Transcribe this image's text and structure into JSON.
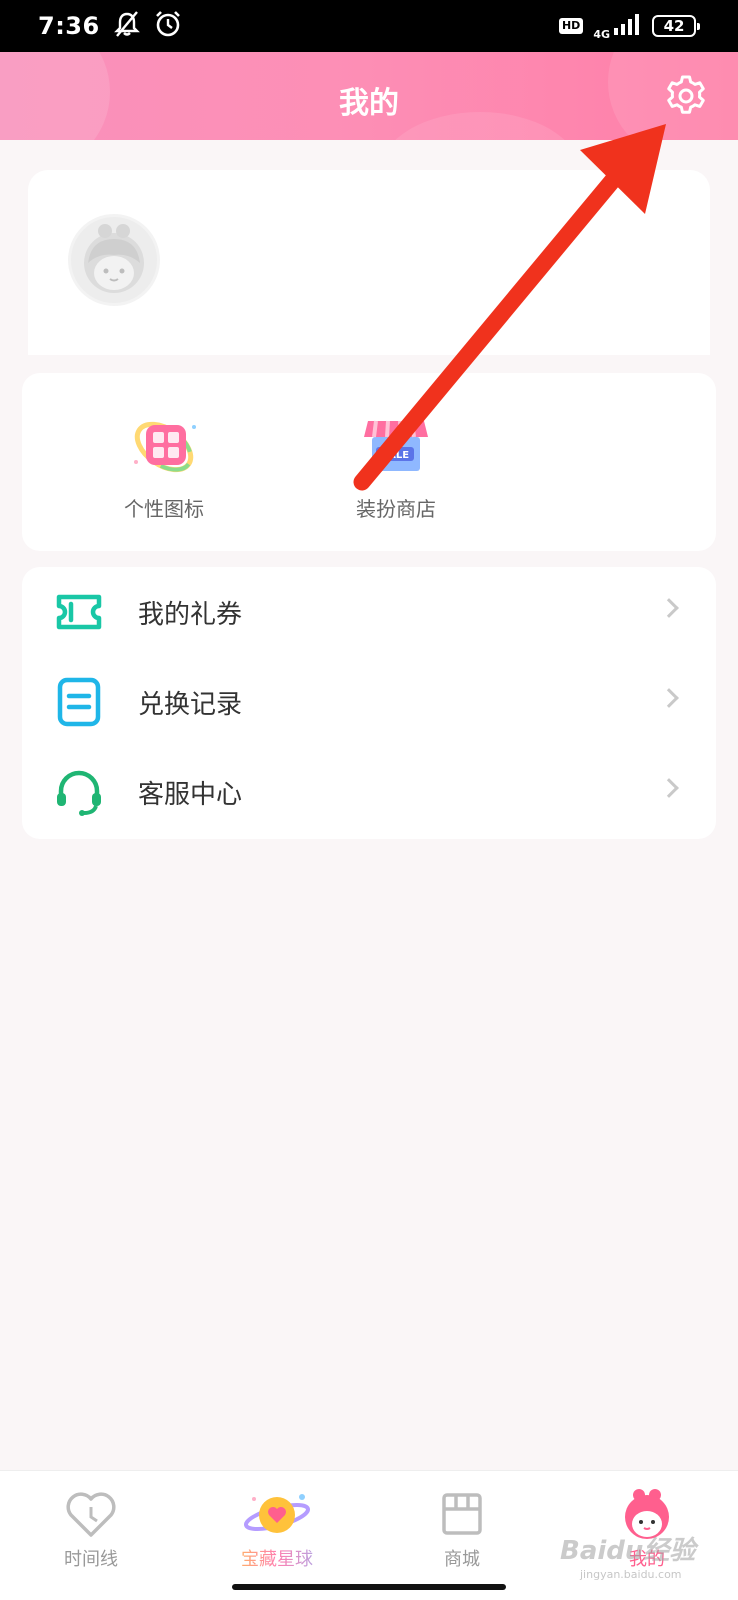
{
  "status_bar": {
    "time": "7:36",
    "hd": "HD",
    "network": "4G",
    "battery": "42"
  },
  "header": {
    "title": "我的"
  },
  "tools": [
    {
      "label": "个性图标",
      "icon": "app-grid-icon"
    },
    {
      "label": "装扮商店",
      "icon": "store-sale-icon"
    }
  ],
  "menu": [
    {
      "label": "我的礼券",
      "icon": "ticket-icon",
      "color": "#19c7a6"
    },
    {
      "label": "兑换记录",
      "icon": "record-icon",
      "color": "#1fb6e8"
    },
    {
      "label": "客服中心",
      "icon": "headset-icon",
      "color": "#1fb573"
    }
  ],
  "tabbar": {
    "tabs": [
      {
        "label": "时间线",
        "icon": "heart-clock-icon"
      },
      {
        "label": "宝藏星球",
        "icon": "planet-icon"
      },
      {
        "label": "商城",
        "icon": "shop-icon"
      },
      {
        "label": "我的",
        "icon": "avatar-girl-icon"
      }
    ]
  },
  "watermark": {
    "text": "Baidu经验",
    "sub": "jingyan.baidu.com"
  },
  "colors": {
    "header_start": "#f991bb",
    "header_end": "#fe7fa8",
    "accent": "#ff5f8e",
    "annotation_arrow": "#f0321d"
  }
}
